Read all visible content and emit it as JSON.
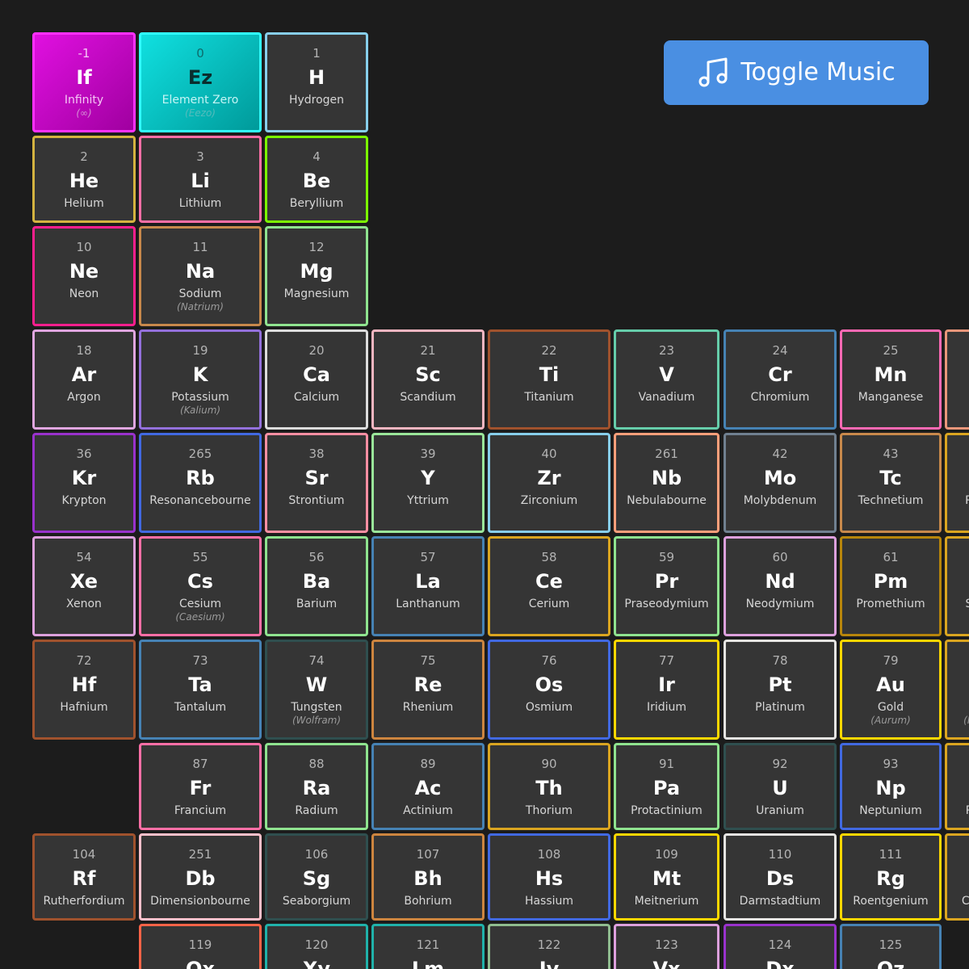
{
  "toolbar": {
    "toggle_music_label": "Toggle Music",
    "toggle_music_icon": "music-note-icon"
  },
  "colors": {
    "background": "#1c1c1c",
    "tile_background": "#353535",
    "button": "#4a8fe2"
  },
  "elements": [
    {
      "num": "-1",
      "sym": "If",
      "name": "Infinity",
      "alt": "(∞)",
      "color": "#ff30ff",
      "special": "if"
    },
    {
      "num": "0",
      "sym": "Ez",
      "name": "Element Zero",
      "alt": "(Eezo)",
      "color": "#30ffff",
      "special": "ez"
    },
    {
      "num": "1",
      "sym": "H",
      "name": "Hydrogen",
      "color": "#87ceeb"
    },
    {
      "num": "2",
      "sym": "He",
      "name": "Helium",
      "color": "#d4b340"
    },
    {
      "num": "3",
      "sym": "Li",
      "name": "Lithium",
      "color": "#ff6fa6"
    },
    {
      "num": "4",
      "sym": "Be",
      "name": "Beryllium",
      "color": "#7cfc00"
    },
    {
      "num": "10",
      "sym": "Ne",
      "name": "Neon",
      "color": "#ff1f8e"
    },
    {
      "num": "11",
      "sym": "Na",
      "name": "Sodium",
      "alt": "(Natrium)",
      "color": "#c8894b"
    },
    {
      "num": "12",
      "sym": "Mg",
      "name": "Magnesium",
      "color": "#8fe38f"
    },
    {
      "num": "18",
      "sym": "Ar",
      "name": "Argon",
      "color": "#e0a6e0"
    },
    {
      "num": "19",
      "sym": "K",
      "name": "Potassium",
      "alt": "(Kalium)",
      "color": "#9370db"
    },
    {
      "num": "20",
      "sym": "Ca",
      "name": "Calcium",
      "color": "#dcdcdc"
    },
    {
      "num": "21",
      "sym": "Sc",
      "name": "Scandium",
      "color": "#f5b6c1"
    },
    {
      "num": "22",
      "sym": "Ti",
      "name": "Titanium",
      "color": "#a0522d"
    },
    {
      "num": "23",
      "sym": "V",
      "name": "Vanadium",
      "color": "#66cdaa"
    },
    {
      "num": "24",
      "sym": "Cr",
      "name": "Chromium",
      "color": "#4682b4"
    },
    {
      "num": "25",
      "sym": "Mn",
      "name": "Manganese",
      "color": "#ff69b4"
    },
    {
      "num": "",
      "sym": "",
      "name": "",
      "color": "#e9967a"
    },
    {
      "num": "36",
      "sym": "Kr",
      "name": "Krypton",
      "color": "#9932cc"
    },
    {
      "num": "265",
      "sym": "Rb",
      "name": "Resonancebourne",
      "color": "#4169e1"
    },
    {
      "num": "38",
      "sym": "Sr",
      "name": "Strontium",
      "color": "#ff8fa3"
    },
    {
      "num": "39",
      "sym": "Y",
      "name": "Yttrium",
      "color": "#9ae69a"
    },
    {
      "num": "40",
      "sym": "Zr",
      "name": "Zirconium",
      "color": "#87ceeb"
    },
    {
      "num": "261",
      "sym": "Nb",
      "name": "Nebulabourne",
      "color": "#ff9f7a"
    },
    {
      "num": "42",
      "sym": "Mo",
      "name": "Molybdenum",
      "color": "#708090"
    },
    {
      "num": "43",
      "sym": "Tc",
      "name": "Technetium",
      "color": "#c8894b"
    },
    {
      "num": "",
      "sym": "",
      "name": "R",
      "color": "#daa520"
    },
    {
      "num": "54",
      "sym": "Xe",
      "name": "Xenon",
      "color": "#dda0dd"
    },
    {
      "num": "55",
      "sym": "Cs",
      "name": "Cesium",
      "alt": "(Caesium)",
      "color": "#ff6fa6"
    },
    {
      "num": "56",
      "sym": "Ba",
      "name": "Barium",
      "color": "#8fe38f"
    },
    {
      "num": "57",
      "sym": "La",
      "name": "Lanthanum",
      "color": "#4682b4"
    },
    {
      "num": "58",
      "sym": "Ce",
      "name": "Cerium",
      "color": "#daa520"
    },
    {
      "num": "59",
      "sym": "Pr",
      "name": "Praseodymium",
      "color": "#8fe38f"
    },
    {
      "num": "60",
      "sym": "Nd",
      "name": "Neodymium",
      "color": "#dda0dd"
    },
    {
      "num": "61",
      "sym": "Pm",
      "name": "Promethium",
      "color": "#b8860b"
    },
    {
      "num": "",
      "sym": "",
      "name": "S",
      "color": "#daa520"
    },
    {
      "num": "72",
      "sym": "Hf",
      "name": "Hafnium",
      "color": "#a0522d"
    },
    {
      "num": "73",
      "sym": "Ta",
      "name": "Tantalum",
      "color": "#4682b4"
    },
    {
      "num": "74",
      "sym": "W",
      "name": "Tungsten",
      "alt": "(Wolfram)",
      "color": "#2f4f4f"
    },
    {
      "num": "75",
      "sym": "Re",
      "name": "Rhenium",
      "color": "#cd853f"
    },
    {
      "num": "76",
      "sym": "Os",
      "name": "Osmium",
      "color": "#4169e1"
    },
    {
      "num": "77",
      "sym": "Ir",
      "name": "Iridium",
      "color": "#ffd700"
    },
    {
      "num": "78",
      "sym": "Pt",
      "name": "Platinum",
      "color": "#e5e4e2"
    },
    {
      "num": "79",
      "sym": "Au",
      "name": "Gold",
      "alt": "(Aurum)",
      "color": "#ffd700"
    },
    {
      "num": "",
      "sym": "",
      "name": "",
      "alt": "(H",
      "color": "#daa520"
    },
    {
      "num": "87",
      "sym": "Fr",
      "name": "Francium",
      "color": "#ff6fa6"
    },
    {
      "num": "88",
      "sym": "Ra",
      "name": "Radium",
      "color": "#8fe38f"
    },
    {
      "num": "89",
      "sym": "Ac",
      "name": "Actinium",
      "color": "#4682b4"
    },
    {
      "num": "90",
      "sym": "Th",
      "name": "Thorium",
      "color": "#daa520"
    },
    {
      "num": "91",
      "sym": "Pa",
      "name": "Protactinium",
      "color": "#8fe38f"
    },
    {
      "num": "92",
      "sym": "U",
      "name": "Uranium",
      "color": "#2f4f4f"
    },
    {
      "num": "93",
      "sym": "Np",
      "name": "Neptunium",
      "color": "#4169e1"
    },
    {
      "num": "",
      "sym": "",
      "name": "P",
      "color": "#daa520"
    },
    {
      "num": "104",
      "sym": "Rf",
      "name": "Rutherfordium",
      "color": "#a0522d"
    },
    {
      "num": "251",
      "sym": "Db",
      "name": "Dimensionbourne",
      "color": "#ffc0cb"
    },
    {
      "num": "106",
      "sym": "Sg",
      "name": "Seaborgium",
      "color": "#2f4f4f"
    },
    {
      "num": "107",
      "sym": "Bh",
      "name": "Bohrium",
      "color": "#cd853f"
    },
    {
      "num": "108",
      "sym": "Hs",
      "name": "Hassium",
      "color": "#4169e1"
    },
    {
      "num": "109",
      "sym": "Mt",
      "name": "Meitnerium",
      "color": "#ffd700"
    },
    {
      "num": "110",
      "sym": "Ds",
      "name": "Darmstadtium",
      "color": "#e5e4e2"
    },
    {
      "num": "111",
      "sym": "Rg",
      "name": "Roentgenium",
      "color": "#ffd700"
    },
    {
      "num": "",
      "sym": "",
      "name": "Co",
      "color": "#daa520"
    },
    {
      "num": "119",
      "sym": "Qx",
      "name": "",
      "color": "#ff6347"
    },
    {
      "num": "120",
      "sym": "Xy",
      "name": "",
      "color": "#20b2aa"
    },
    {
      "num": "121",
      "sym": "Lm",
      "name": "",
      "color": "#20b2aa"
    },
    {
      "num": "122",
      "sym": "Jv",
      "name": "",
      "color": "#8fbc8f"
    },
    {
      "num": "123",
      "sym": "Vx",
      "name": "",
      "color": "#dda0dd"
    },
    {
      "num": "124",
      "sym": "Dx",
      "name": "",
      "color": "#9932cc"
    },
    {
      "num": "125",
      "sym": "Qz",
      "name": "",
      "color": "#4682b4"
    }
  ]
}
